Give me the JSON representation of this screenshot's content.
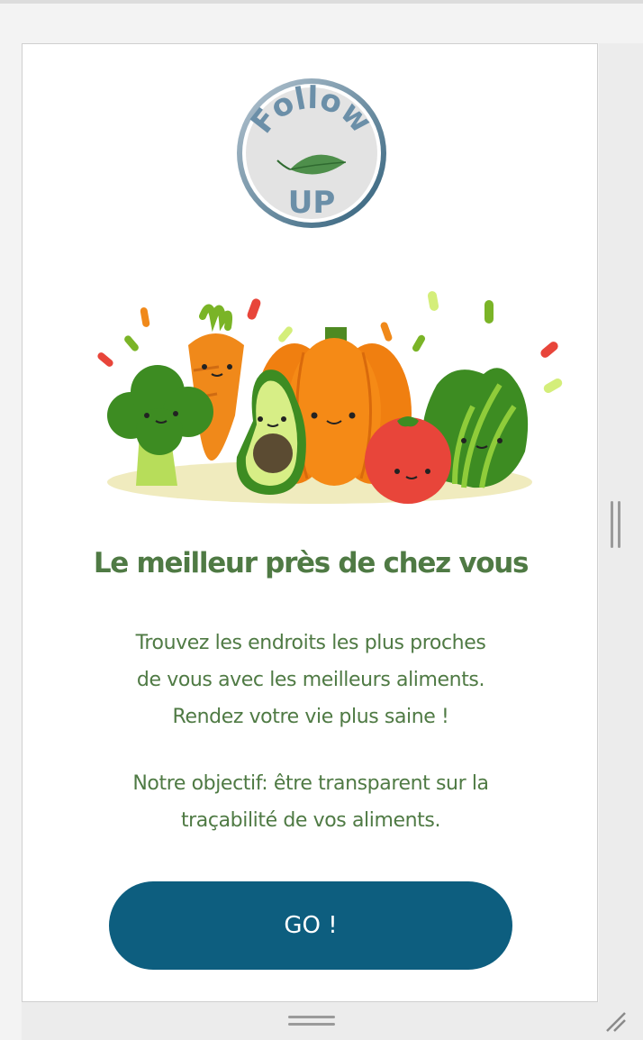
{
  "logo": {
    "text_top": "Follow",
    "text_bottom": "UP",
    "icon": "leaf-icon",
    "colors": {
      "ring": "#3f6d85",
      "leaf": "#4e8f4b",
      "text": "#6b8fa8"
    }
  },
  "illustration": {
    "items": [
      "broccoli",
      "carrot",
      "avocado",
      "pumpkin",
      "tomato",
      "lettuce"
    ]
  },
  "headline": "Le meilleur près de chez vous",
  "description": {
    "lines": [
      "Trouvez les endroits les plus proches",
      "de vous avec les meilleurs aliments.",
      "Rendez votre vie plus saine !"
    ]
  },
  "objective": {
    "lines": [
      "Notre objectif: être transparent sur la",
      "traçabilité de vos aliments."
    ]
  },
  "cta": {
    "label": "GO !",
    "color": "#0d5e7f"
  },
  "theme": {
    "text_green": "#4f7a44"
  }
}
